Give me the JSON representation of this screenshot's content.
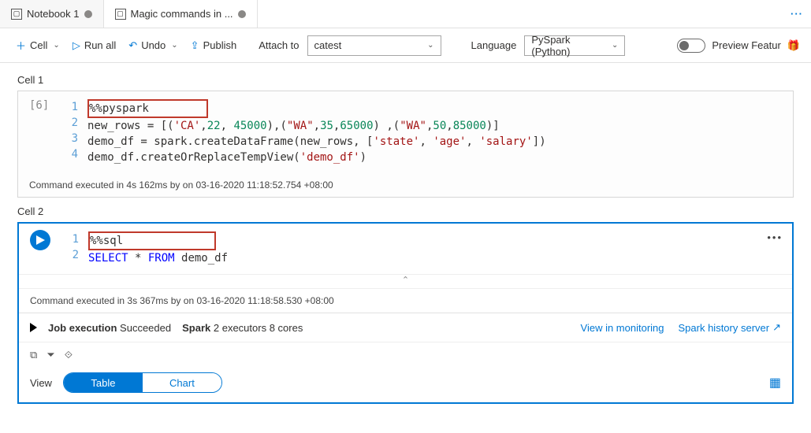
{
  "tabs": [
    {
      "label": "Notebook 1",
      "active": false
    },
    {
      "label": "Magic commands in ...",
      "active": true
    }
  ],
  "toolbar": {
    "cell": "Cell",
    "runall": "Run all",
    "undo": "Undo",
    "publish": "Publish",
    "attach_label": "Attach to",
    "attach_value": "catest",
    "language_label": "Language",
    "language_value": "PySpark (Python)",
    "preview": "Preview Featur"
  },
  "cell1": {
    "label": "Cell 1",
    "badge": "[6]",
    "lines": [
      "1",
      "2",
      "3",
      "4"
    ],
    "magic": "%%pyspark",
    "l2_a": "new_rows = [(",
    "l2_s1": "'CA'",
    "l2_b": ",",
    "l2_n1": "22",
    "l2_c": ", ",
    "l2_n2": "45000",
    "l2_d": "),(",
    "l2_s2": "\"WA\"",
    "l2_e": ",",
    "l2_n3": "35",
    "l2_f": ",",
    "l2_n4": "65000",
    "l2_g": ") ,(",
    "l2_s3": "\"WA\"",
    "l2_h": ",",
    "l2_n5": "50",
    "l2_i": ",",
    "l2_n6": "85000",
    "l2_j": ")]",
    "l3_a": "demo_df = spark.createDataFrame(new_rows, [",
    "l3_s1": "'state'",
    "l3_b": ", ",
    "l3_s2": "'age'",
    "l3_c": ", ",
    "l3_s3": "'salary'",
    "l3_d": "])",
    "l4_a": "demo_df.createOrReplaceTempView(",
    "l4_s1": "'demo_df'",
    "l4_b": ")",
    "footer": "Command executed in 4s 162ms by        on 03-16-2020 11:18:52.754 +08:00"
  },
  "cell2": {
    "label": "Cell 2",
    "lines": [
      "1",
      "2"
    ],
    "magic": "%%sql",
    "l2_kw1": "SELECT",
    "l2_a": " * ",
    "l2_kw2": "FROM",
    "l2_b": " demo_df",
    "footer": "Command executed in 3s 367ms by        on 03-16-2020 11:18:58.530 +08:00",
    "job_label": "Job execution",
    "job_status": "Succeeded",
    "spark_label": "Spark",
    "spark_detail": "2 executors 8 cores",
    "link_monitoring": "View in monitoring",
    "link_history": "Spark history server",
    "view_label": "View",
    "pill_table": "Table",
    "pill_chart": "Chart",
    "more": "•••"
  }
}
